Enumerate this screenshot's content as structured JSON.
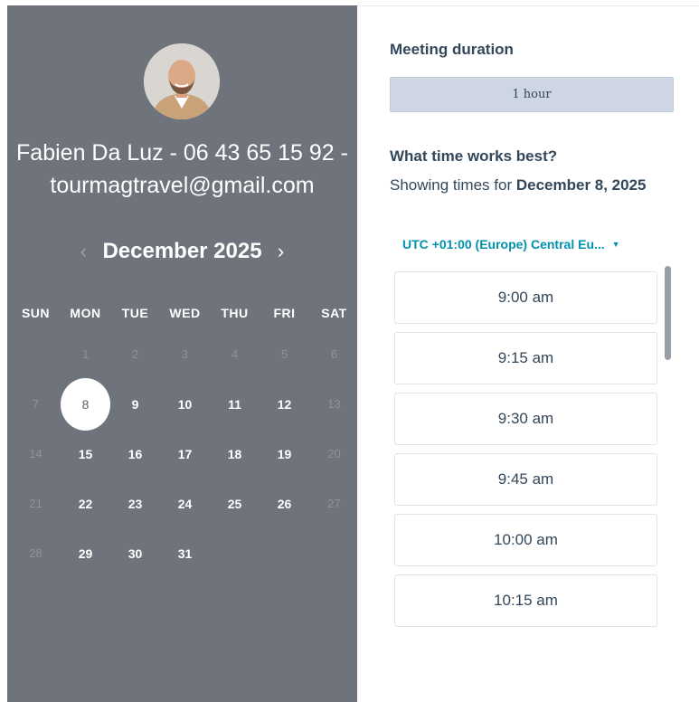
{
  "host": {
    "name": "Fabien Da Luz - 06 43 65 15 92 - tourmagtravel@gmail.com"
  },
  "calendar": {
    "month_label": "December 2025",
    "prev_icon": "chevron-left-icon",
    "next_icon": "chevron-right-icon",
    "weekdays": [
      "SUN",
      "MON",
      "TUE",
      "WED",
      "THU",
      "FRI",
      "SAT"
    ],
    "selected_day": "8",
    "days": [
      {
        "label": "",
        "state": "empty"
      },
      {
        "label": "1",
        "state": "disabled"
      },
      {
        "label": "2",
        "state": "disabled"
      },
      {
        "label": "3",
        "state": "disabled"
      },
      {
        "label": "4",
        "state": "disabled"
      },
      {
        "label": "5",
        "state": "disabled"
      },
      {
        "label": "6",
        "state": "disabled"
      },
      {
        "label": "7",
        "state": "disabled"
      },
      {
        "label": "8",
        "state": "selected"
      },
      {
        "label": "9",
        "state": "available"
      },
      {
        "label": "10",
        "state": "available"
      },
      {
        "label": "11",
        "state": "available"
      },
      {
        "label": "12",
        "state": "available"
      },
      {
        "label": "13",
        "state": "disabled"
      },
      {
        "label": "14",
        "state": "disabled"
      },
      {
        "label": "15",
        "state": "available"
      },
      {
        "label": "16",
        "state": "available"
      },
      {
        "label": "17",
        "state": "available"
      },
      {
        "label": "18",
        "state": "available"
      },
      {
        "label": "19",
        "state": "available"
      },
      {
        "label": "20",
        "state": "disabled"
      },
      {
        "label": "21",
        "state": "disabled"
      },
      {
        "label": "22",
        "state": "available"
      },
      {
        "label": "23",
        "state": "available"
      },
      {
        "label": "24",
        "state": "available"
      },
      {
        "label": "25",
        "state": "available"
      },
      {
        "label": "26",
        "state": "available"
      },
      {
        "label": "27",
        "state": "disabled"
      },
      {
        "label": "28",
        "state": "disabled"
      },
      {
        "label": "29",
        "state": "available"
      },
      {
        "label": "30",
        "state": "available"
      },
      {
        "label": "31",
        "state": "available"
      }
    ]
  },
  "meeting": {
    "duration_title": "Meeting duration",
    "duration_value": "1 hour",
    "time_title": "What time works best?",
    "showing_prefix": "Showing times for ",
    "showing_date": "December 8, 2025",
    "timezone": "UTC +01:00 (Europe) Central Eu...",
    "slots": [
      "9:00 am",
      "9:15 am",
      "9:30 am",
      "9:45 am",
      "10:00 am",
      "10:15 am"
    ]
  },
  "colors": {
    "left_panel": "#6e737c",
    "accent": "#0091ae",
    "text": "#33475b"
  }
}
